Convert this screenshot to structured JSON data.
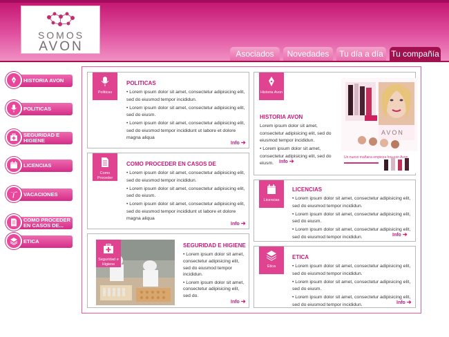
{
  "brand": {
    "line1": "SOMOS",
    "line2": "AVON"
  },
  "tabs": [
    {
      "label": "Asociados"
    },
    {
      "label": "Novedades"
    },
    {
      "label": "Tu día a día"
    },
    {
      "label": "Tu compañía"
    }
  ],
  "sidebar": {
    "items": [
      {
        "label": "HISTORIA AVON",
        "icon": "pen-nib-icon"
      },
      {
        "label": "POLITICAS",
        "icon": "microphone-icon"
      },
      {
        "label": "SEGURIDAD E HIGIENE",
        "icon": "first-aid-kit-icon"
      },
      {
        "label": "LICENCIAS",
        "icon": "calendar-icon"
      },
      {
        "label": "VACACIONES",
        "icon": "palm-tree-icon"
      },
      {
        "label": "COMO PROCEDER EN CASOS DE...",
        "icon": "document-icon"
      },
      {
        "label": "ETICA",
        "icon": "layers-icon"
      }
    ]
  },
  "cards": {
    "politicas": {
      "badge": "Politicas",
      "title": "POLITICAS",
      "paragraphs": [
        "• Lorem ipsum dolor sit amet, consectetur adipisicing elit, sed do eiusmod tempor incididun.",
        "• Lorem ipsum dolor sit amet, consectetur adipisicing elit, sed do eiusm.",
        "• Lorem ipsum dolor sit amet, consectetur adipisicing elit, sed do eiusmod tempor incididunt ut labore et dolore magna aliqua"
      ],
      "info": "Info"
    },
    "historia": {
      "badge": "Historia Avon",
      "title": "HISTORIA AVON",
      "paragraphs": [
        "Lorem ipsum dolor sit amet, consectetur adipisicing elit, sed do eiusmod tempor incididun.",
        "• Lorem ipsum dolor sit amet, consectetur adipisicing elit, sed do eiusm."
      ],
      "info": "Info",
      "ad": {
        "brand": "AVON",
        "tagline": "Un nuevo mañana empieza hoy con Avon"
      }
    },
    "como_proceder": {
      "badge": "Como Proceder",
      "title": "COMO PROCEDER EN CASOS DE",
      "paragraphs": [
        "• Lorem ipsum dolor sit amet, consectetur adipisicing elit, sed do eiusmod tempor incididun.",
        "• Lorem ipsum dolor sit amet, consectetur adipisicing elit, sed do eiusm.",
        "• Lorem ipsum dolor sit amet, consectetur adipisicing elit, sed do eiusmod tempor incididunt ut labore et dolore magna aliqua"
      ],
      "info": "Info"
    },
    "licencias": {
      "badge": "Licencias",
      "title": "LICENCIAS",
      "paragraphs": [
        "• Lorem ipsum dolor sit amet, consectetur adipisicing elit, sed do eiusmod tempor incididun.",
        "• Lorem ipsum dolor sit amet, consectetur adipisicing elit, sed do eiusm.",
        "• Lorem ipsum dolor sit amet, consectetur adipisicing elit, sed do eiusmod tempor incididun."
      ],
      "info": "Info"
    },
    "seguridad": {
      "badge": "Seguridad e Higiene",
      "title": "SEGURIDAD E HIGIENE",
      "paragraphs": [
        "• Lorem ipsum dolor sit amet, consectetur adipisicing elit, sed do eiusmod tempor incididun.",
        "• Lorem ipsum dolor sit amet, consectetur adipisicing elit, sed do."
      ],
      "info": "Info"
    },
    "etica": {
      "badge": "Etica",
      "title": "ETICA",
      "paragraphs": [
        "• Lorem ipsum dolor sit amet, consectetur adipisicing elit, sed do eiusmod tempor incididun.",
        "• Lorem ipsum dolor sit amet, consectetur adipisicing elit, sed do eiusm.",
        "• Lorem ipsum dolor sit amet, consectetur adipisicing elit, sed do eiusmod tempor incididun."
      ],
      "info": "Info"
    }
  },
  "colors": {
    "brand": "#e0438f",
    "brand_dark": "#a1104f",
    "title": "#c71a78"
  }
}
